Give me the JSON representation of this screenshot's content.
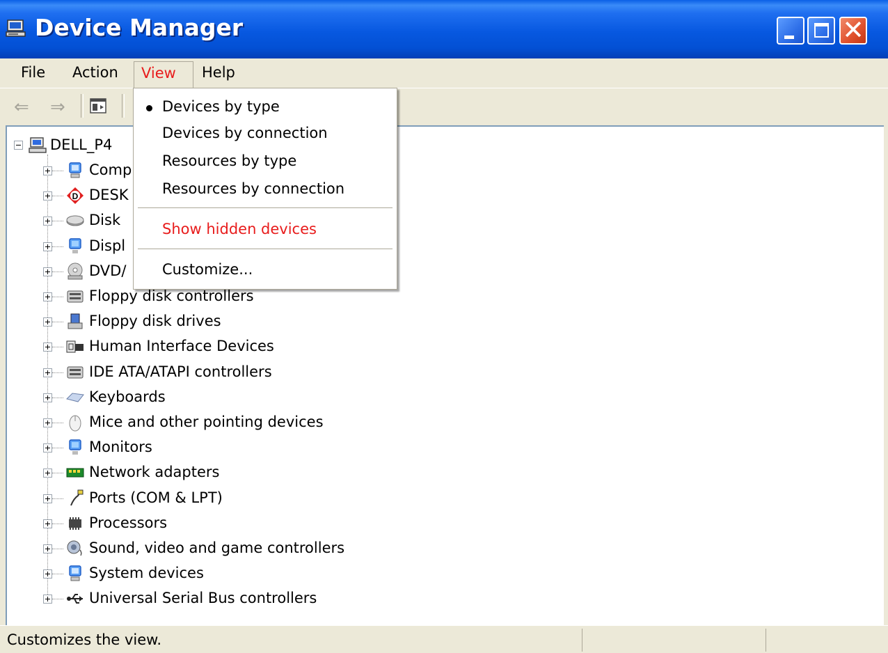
{
  "window": {
    "title": "Device Manager",
    "icon": "computer-icon",
    "title_color": "#ffffff",
    "titlebar_color": "#0758e0",
    "controls": [
      "minimize-icon",
      "maximize-icon",
      "close-icon"
    ],
    "close_glyph": "✕"
  },
  "menubar": {
    "items": [
      {
        "label": "File"
      },
      {
        "label": "Action"
      },
      {
        "label": "View"
      },
      {
        "label": "Help"
      }
    ],
    "active": "View"
  },
  "toolbar": {
    "back_glyph": "⇐",
    "forward_glyph": "⇒",
    "buttons": [
      "back-arrow-icon",
      "forward-arrow-icon",
      "show-hide-console-tree-icon"
    ]
  },
  "view_menu": {
    "items": [
      {
        "label": "Devices by type",
        "checked": true
      },
      {
        "label": "Devices by connection"
      },
      {
        "label": "Resources by type"
      },
      {
        "label": "Resources by connection"
      },
      {
        "label": "Show hidden devices",
        "highlight_color": "#e81c1c"
      },
      {
        "label": "Customize..."
      }
    ]
  },
  "tree": {
    "root": {
      "label": "DELL_P4",
      "icon": "computer-icon"
    },
    "children": [
      {
        "label": "Comp",
        "icon": "computer-icon"
      },
      {
        "label": "DESK",
        "icon": "daemon-tools-icon"
      },
      {
        "label": "Disk",
        "icon": "disk-drive-icon"
      },
      {
        "label": "Displ",
        "icon": "display-adapter-icon"
      },
      {
        "label": "DVD/",
        "icon": "dvd-drive-icon"
      },
      {
        "label": "Floppy disk controllers",
        "icon": "floppy-controller-icon"
      },
      {
        "label": "Floppy disk drives",
        "icon": "floppy-drive-icon"
      },
      {
        "label": "Human Interface Devices",
        "icon": "hid-icon"
      },
      {
        "label": "IDE ATA/ATAPI controllers",
        "icon": "ide-controller-icon"
      },
      {
        "label": "Keyboards",
        "icon": "keyboard-icon"
      },
      {
        "label": "Mice and other pointing devices",
        "icon": "mouse-icon"
      },
      {
        "label": "Monitors",
        "icon": "monitor-icon"
      },
      {
        "label": "Network adapters",
        "icon": "network-adapter-icon"
      },
      {
        "label": "Ports (COM & LPT)",
        "icon": "port-icon"
      },
      {
        "label": "Processors",
        "icon": "processor-icon"
      },
      {
        "label": "Sound, video and game controllers",
        "icon": "sound-icon"
      },
      {
        "label": "System devices",
        "icon": "system-devices-icon"
      },
      {
        "label": "Universal Serial Bus controllers",
        "icon": "usb-icon"
      }
    ]
  },
  "statusbar": {
    "text": "Customizes the view."
  }
}
